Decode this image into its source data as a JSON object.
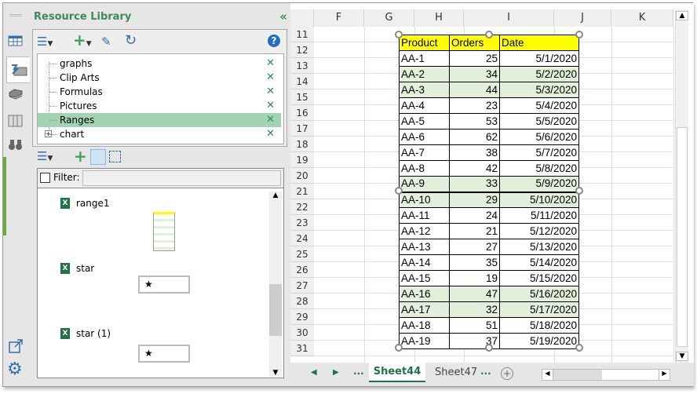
{
  "panel": {
    "title": "Resource Library",
    "collapse_icon": "double-chevron-left",
    "tree": [
      {
        "label": "graphs"
      },
      {
        "label": "Clip Arts"
      },
      {
        "label": "Formulas"
      },
      {
        "label": "Pictures"
      },
      {
        "label": "Ranges",
        "selected": true
      },
      {
        "label": "chart",
        "expandable": true
      }
    ],
    "filter_label": "Filter:",
    "filter_value": "",
    "entries": [
      {
        "label": "range1"
      },
      {
        "label": "star"
      },
      {
        "label": "star (1)"
      }
    ],
    "accent": "#3d8a55",
    "selected_bg": "#a0d4b4"
  },
  "sheet": {
    "columns": [
      "F",
      "G",
      "H",
      "I",
      "J",
      "K"
    ],
    "rows": [
      "11",
      "12",
      "13",
      "14",
      "15",
      "16",
      "17",
      "18",
      "19",
      "20",
      "21",
      "22",
      "23",
      "24",
      "25",
      "26",
      "27",
      "28",
      "29",
      "30",
      "31"
    ],
    "table": {
      "headers": [
        "Product",
        "Orders",
        "Date"
      ],
      "header_bg": "#ffff00",
      "highlight_bg": "#e2efda",
      "rows": [
        [
          "AA-1",
          "25",
          "5/1/2020",
          false
        ],
        [
          "AA-2",
          "34",
          "5/2/2020",
          true
        ],
        [
          "AA-3",
          "44",
          "5/3/2020",
          true
        ],
        [
          "AA-4",
          "23",
          "5/4/2020",
          false
        ],
        [
          "AA-5",
          "53",
          "5/5/2020",
          false
        ],
        [
          "AA-6",
          "62",
          "5/6/2020",
          false
        ],
        [
          "AA-7",
          "38",
          "5/7/2020",
          false
        ],
        [
          "AA-8",
          "42",
          "5/8/2020",
          false
        ],
        [
          "AA-9",
          "33",
          "5/9/2020",
          true
        ],
        [
          "AA-10",
          "29",
          "5/10/2020",
          true
        ],
        [
          "AA-11",
          "24",
          "5/11/2020",
          false
        ],
        [
          "AA-12",
          "21",
          "5/12/2020",
          false
        ],
        [
          "AA-13",
          "27",
          "5/13/2020",
          false
        ],
        [
          "AA-14",
          "35",
          "5/14/2020",
          false
        ],
        [
          "AA-15",
          "19",
          "5/15/2020",
          false
        ],
        [
          "AA-16",
          "47",
          "5/16/2020",
          true
        ],
        [
          "AA-17",
          "32",
          "5/17/2020",
          true
        ],
        [
          "AA-18",
          "51",
          "5/18/2020",
          false
        ],
        [
          "AA-19",
          "37",
          "5/19/2020",
          false
        ]
      ]
    },
    "tabs": {
      "active": "Sheet44",
      "other": "Sheet47",
      "more": "..."
    }
  }
}
